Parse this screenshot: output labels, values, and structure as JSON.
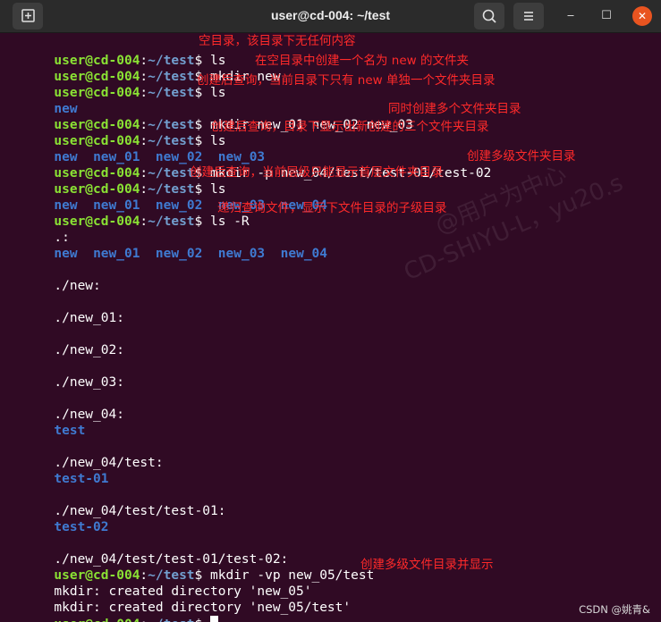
{
  "window": {
    "title": "user@cd-004: ~/test",
    "controls": {
      "minimize": "‒",
      "maximize": "☐",
      "close": "✕"
    }
  },
  "toolbar": {
    "new_tab_icon": "new-tab-icon",
    "search_icon": "search-icon",
    "menu_icon": "hamburger-menu-icon"
  },
  "prompt": {
    "user": "user@cd-004",
    "colon": ":",
    "path": "~/test",
    "dollar": "$"
  },
  "terminal": {
    "commands": [
      " ls",
      " mkdir new",
      " ls",
      " mkdir new_01 new_02 new_03",
      " ls",
      " mkdir -p new_04/test/test-01/test-02",
      " ls",
      " ls -R",
      " mkdir -vp new_05/test"
    ],
    "ls_new": "new",
    "ls_three": [
      "new",
      "new_01",
      "new_02",
      "new_03"
    ],
    "ls_four": [
      "new",
      "new_01",
      "new_02",
      "new_03",
      "new_04"
    ],
    "recursive": {
      "root_label": ".:",
      "root_entries": [
        "new",
        "new_01",
        "new_02",
        "new_03",
        "new_04"
      ],
      "headers": {
        "new": "./new:",
        "new_01": "./new_01:",
        "new_02": "./new_02:",
        "new_03": "./new_03:",
        "new_04": "./new_04:",
        "new_04_test": "./new_04/test:",
        "new_04_test_test01": "./new_04/test/test-01:",
        "new_04_test_test01_test02": "./new_04/test/test-01/test-02:"
      },
      "children": {
        "new_04": "test",
        "new_04_test": "test-01",
        "new_04_test_test01": "test-02"
      }
    },
    "verbose_output": [
      "mkdir: created directory 'new_05'",
      "mkdir: created directory 'new_05/test'"
    ]
  },
  "annotations": [
    "空目录，该目录下无任何内容",
    "在空目录中创建一个名为 new 的文件夹",
    "创建后查询，当前目录下只有 new 单独一个文件夹目录",
    "同时创建多个文件夹目录",
    "创建后查询，目录下显示出新创建的三个文件夹目录",
    "创建多级文件夹目录",
    "创建后查询，当前层级只能显示首层文件夹目录",
    "递归查询文件，显示下文件目录的子级目录",
    "创建多级文件目录并显示"
  ],
  "watermark": {
    "line1": "@用户为中心",
    "line2": "CD-SHIYU-L，yu20.s"
  },
  "footer": {
    "credit": "CSDN @姚青&"
  },
  "colors": {
    "background": "#300a24",
    "prompt_user": "#8ae234",
    "prompt_path": "#729fcf",
    "directory": "#3f7ad1",
    "annotation": "#ff2a2a",
    "close_button": "#e95420"
  }
}
